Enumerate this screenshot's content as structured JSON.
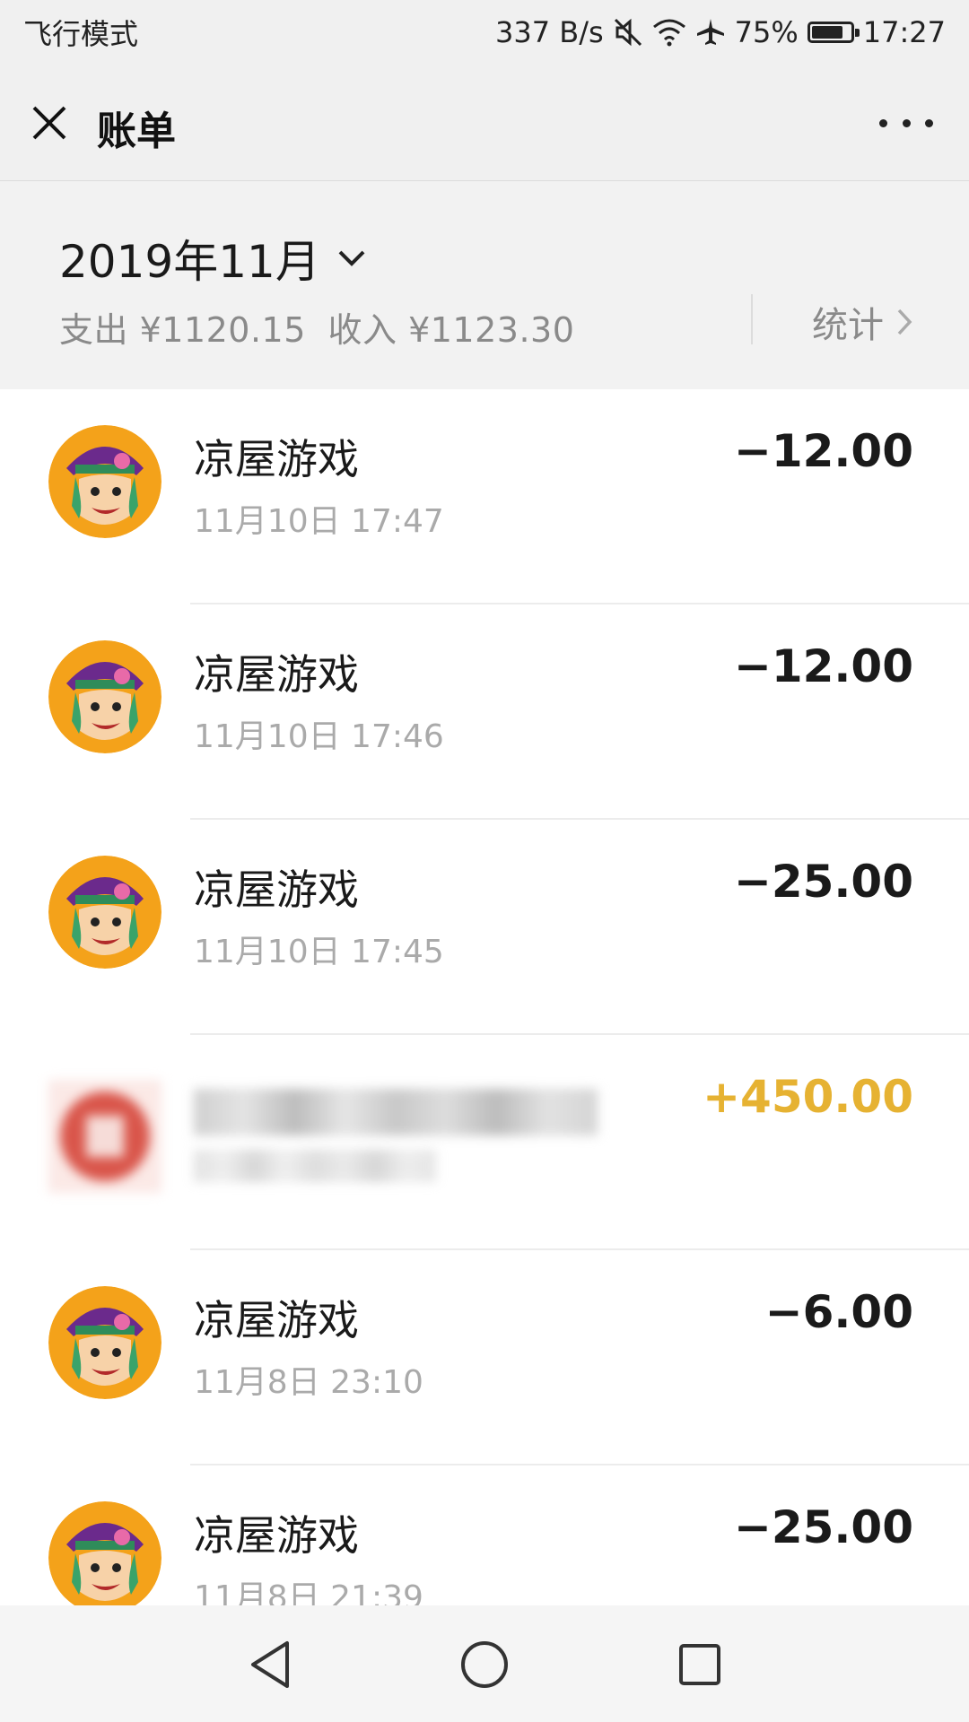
{
  "status_bar": {
    "mode": "飞行模式",
    "net_speed": "337 B/s",
    "battery_percent": "75%",
    "battery_level": 0.75,
    "time": "17:27",
    "icons": [
      "mute-icon",
      "wifi-icon",
      "airplane-icon",
      "battery-icon"
    ]
  },
  "nav": {
    "title": "账单",
    "close_icon": "close-icon",
    "more_icon": "more-icon"
  },
  "summary": {
    "month": "2019年11月",
    "expense": "支出 ¥1120.15",
    "income": "收入 ¥1123.30",
    "stats_label": "统计"
  },
  "transactions": [
    {
      "title": "凉屋游戏",
      "time": "11月10日 17:47",
      "amount": "−12.00",
      "type": "expense"
    },
    {
      "title": "凉屋游戏",
      "time": "11月10日 17:46",
      "amount": "−12.00",
      "type": "expense"
    },
    {
      "title": "凉屋游戏",
      "time": "11月10日 17:45",
      "amount": "−25.00",
      "type": "expense"
    },
    {
      "title": "",
      "time": "",
      "amount": "+450.00",
      "type": "income"
    },
    {
      "title": "凉屋游戏",
      "time": "11月8日 23:10",
      "amount": "−6.00",
      "type": "expense"
    },
    {
      "title": "凉屋游戏",
      "time": "11月8日 21:39",
      "amount": "−25.00",
      "type": "expense"
    }
  ],
  "colors": {
    "income": "#e6b232",
    "expense": "#1a1a1a",
    "secondary_text": "#8a8a8a",
    "avatar_bg": "#f4a21a"
  },
  "system_nav": [
    "back-icon",
    "home-icon",
    "recents-icon"
  ]
}
